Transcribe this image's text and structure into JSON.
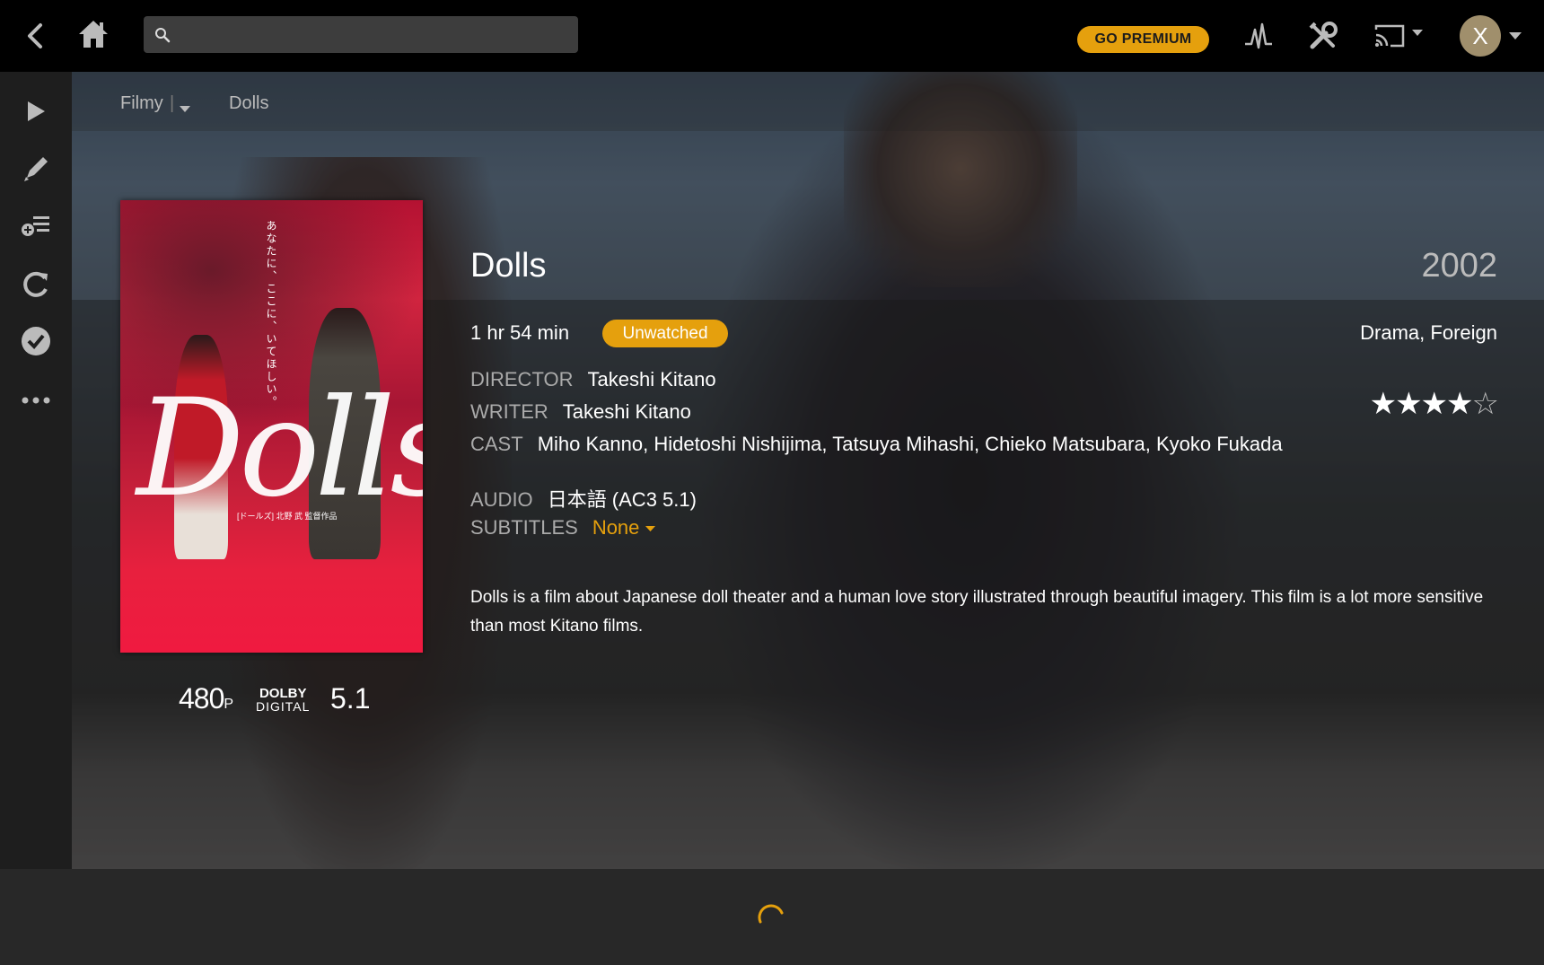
{
  "topbar": {
    "search_placeholder": "",
    "premium_label": "GO PREMIUM",
    "avatar_letter": "X"
  },
  "breadcrumb": {
    "library": "Filmy",
    "current": "Dolls"
  },
  "poster": {
    "title_art": "Dolls",
    "jp_tagline": "あなたに、ここに、いてほしい。",
    "credit_line": "[ドールズ] 北野 武 監督作品"
  },
  "badges": {
    "resolution": "480",
    "resolution_suffix": "P",
    "audio_brand_top": "DOLBY",
    "audio_brand_bottom": "DIGITAL",
    "channels": "5.1"
  },
  "movie": {
    "title": "Dolls",
    "year": "2002",
    "duration": "1 hr 54 min",
    "status": "Unwatched",
    "genres": "Drama, Foreign",
    "director_label": "DIRECTOR",
    "director": "Takeshi Kitano",
    "writer_label": "WRITER",
    "writer": "Takeshi Kitano",
    "cast_label": "CAST",
    "cast": "Miho Kanno, Hidetoshi Nishijima, Tatsuya Mihashi, Chieko Matsubara, Kyoko Fukada",
    "audio_label": "AUDIO",
    "audio": "日本語 (AC3 5.1)",
    "subtitles_label": "SUBTITLES",
    "subtitles": "None",
    "rating_stars": 4,
    "rating_max": 5,
    "summary": "Dolls is a film about Japanese doll theater and a human love story illustrated through beautiful imagery. This film is a lot more sensitive than most Kitano films."
  },
  "colors": {
    "accent": "#e5a00d",
    "topbar": "#000000",
    "sidebar": "#1e1e1e"
  }
}
